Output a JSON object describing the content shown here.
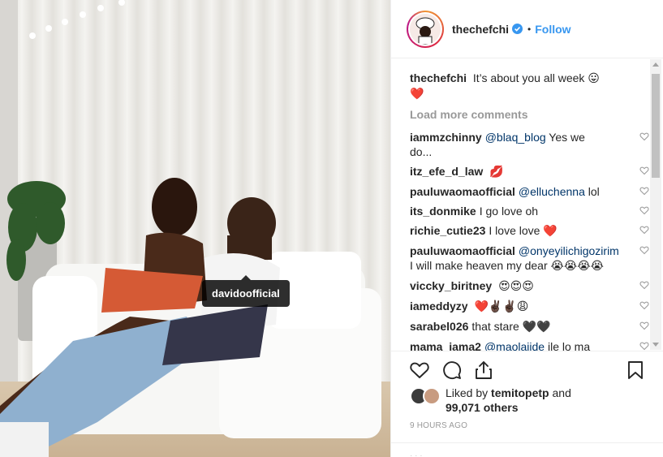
{
  "photo": {
    "tagged_user": "davidoofficial"
  },
  "header": {
    "username": "thechefchi",
    "separator": "•",
    "follow_label": "Follow"
  },
  "caption": {
    "username": "thechefchi",
    "text": "It’s about you all week",
    "emojis": "😛❤️"
  },
  "load_more_label": "Load more comments",
  "comments": [
    {
      "user": "iammzchinny",
      "mention": "@blaq_blog",
      "text": "Yes we do...",
      "emoji": ""
    },
    {
      "user": "itz_efe_d_law",
      "mention": "",
      "text": "",
      "emoji": "💋"
    },
    {
      "user": "pauluwaomaofficial",
      "mention": "@elluchenna",
      "text": "lol",
      "emoji": ""
    },
    {
      "user": "its_donmike",
      "mention": "",
      "text": "I go love oh",
      "emoji": ""
    },
    {
      "user": "richie_cutie23",
      "mention": "",
      "text": "I love love",
      "emoji": "❤️"
    },
    {
      "user": "pauluwaomaofficial",
      "mention": "@onyeyilichigozirim",
      "text": "I will make heaven my dear",
      "emoji": "😭😭😭😭"
    },
    {
      "user": "viccky_biritney",
      "mention": "",
      "text": "",
      "emoji": "😍😍😍"
    },
    {
      "user": "iameddyzy",
      "mention": "",
      "text": "",
      "emoji": "❤️✌🏿✌🏿😩"
    },
    {
      "user": "sarabel026",
      "mention": "",
      "text": "that stare",
      "emoji": "🖤🖤"
    },
    {
      "user": "mama_jama2",
      "mention": "@maolajide",
      "text": "ile lo ma gbe",
      "emoji": "😁"
    }
  ],
  "likes": {
    "prefix": "Liked by",
    "user": "temitopetp",
    "conjunction": "and",
    "count": "99,071 others"
  },
  "timestamp": "9 HOURS AGO",
  "colors": {
    "link_blue": "#3897f0",
    "mention_blue": "#003569",
    "muted": "#999999",
    "text": "#262626"
  },
  "icons": {
    "like": "heart-icon",
    "comment": "comment-icon",
    "share": "share-icon",
    "save": "bookmark-icon",
    "verified": "verified-badge-icon"
  }
}
